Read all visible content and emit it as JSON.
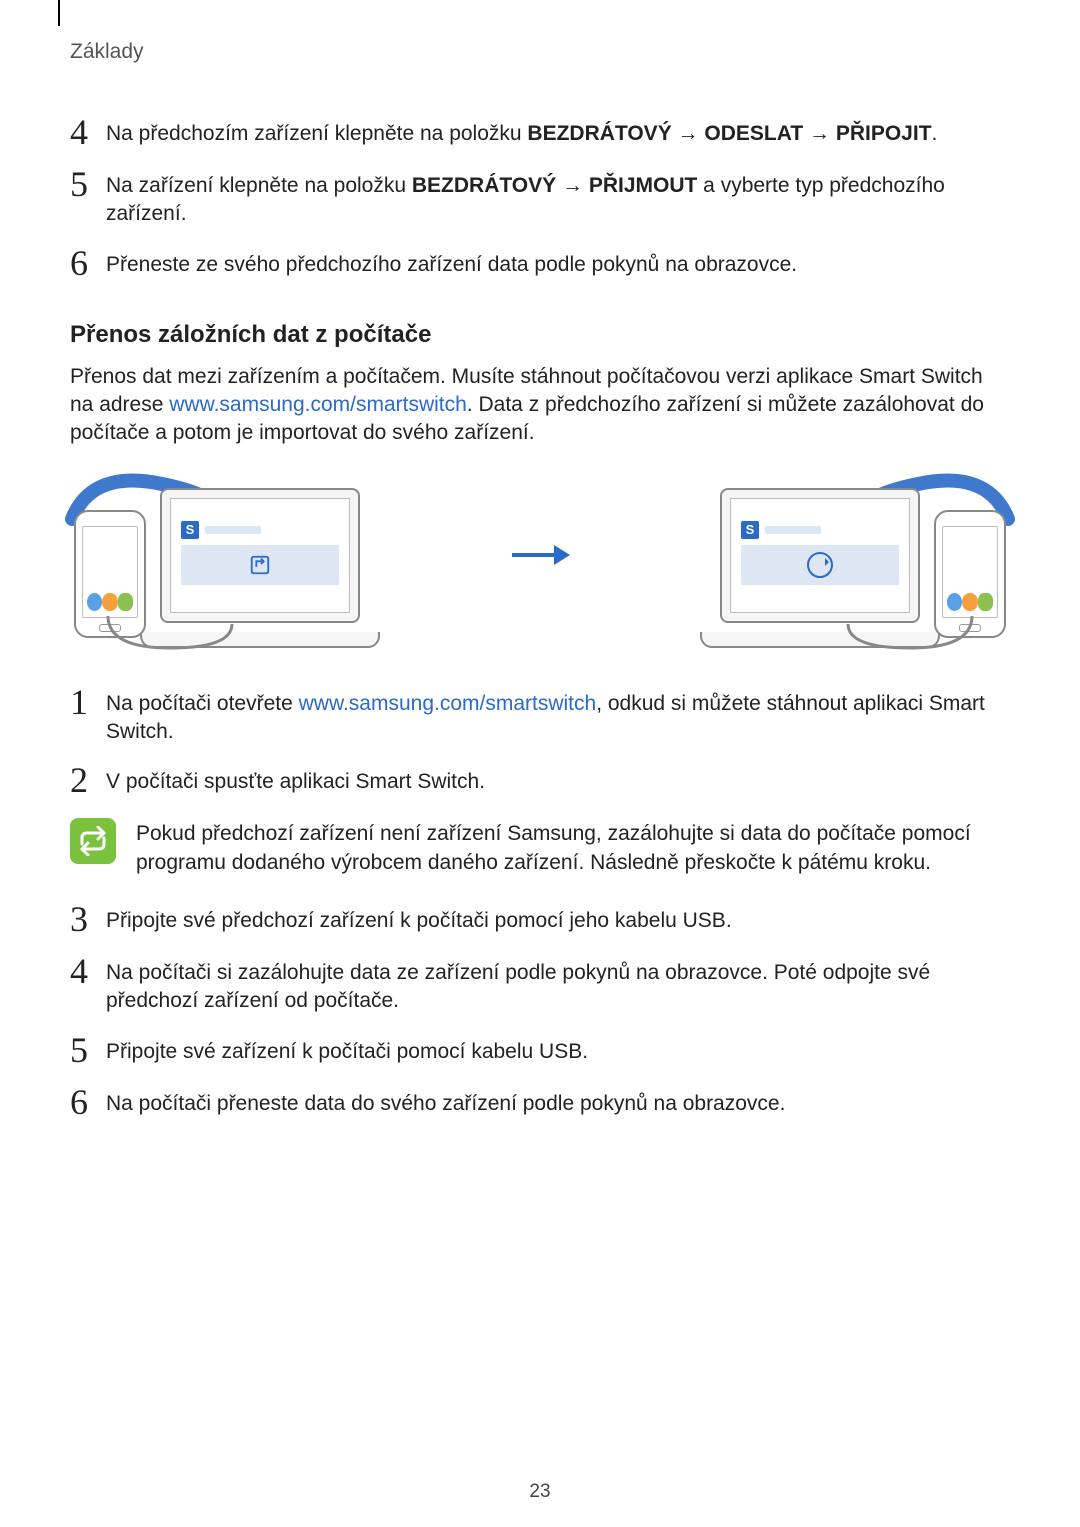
{
  "header": "Základy",
  "topSteps": [
    {
      "num": "4",
      "segments": [
        {
          "t": "Na předchozím zařízení klepněte na položku "
        },
        {
          "t": "BEZDRÁTOVÝ",
          "bold": true
        },
        {
          "t": " → "
        },
        {
          "t": "ODESLAT",
          "bold": true
        },
        {
          "t": " → "
        },
        {
          "t": "PŘIPOJIT",
          "bold": true
        },
        {
          "t": "."
        }
      ]
    },
    {
      "num": "5",
      "segments": [
        {
          "t": "Na zařízení klepněte na položku "
        },
        {
          "t": "BEZDRÁTOVÝ",
          "bold": true
        },
        {
          "t": " → "
        },
        {
          "t": "PŘIJMOUT",
          "bold": true
        },
        {
          "t": " a vyberte typ předchozího zařízení."
        }
      ]
    },
    {
      "num": "6",
      "segments": [
        {
          "t": "Přeneste ze svého předchozího zařízení data podle pokynů na obrazovce."
        }
      ]
    }
  ],
  "h2": "Přenos záložních dat z počítače",
  "intro": {
    "segments": [
      {
        "t": "Přenos dat mezi zařízením a počítačem. Musíte stáhnout počítačovou verzi aplikace Smart Switch na adrese "
      },
      {
        "t": "www.samsung.com/smartswitch",
        "link": true
      },
      {
        "t": ". Data z předchozího zařízení si můžete zazálohovat do počítače a potom je importovat do svého zařízení."
      }
    ]
  },
  "appBadge": "S",
  "steps": [
    {
      "num": "1",
      "segments": [
        {
          "t": "Na počítači otevřete "
        },
        {
          "t": "www.samsung.com/smartswitch",
          "link": true
        },
        {
          "t": ", odkud si můžete stáhnout aplikaci Smart Switch."
        }
      ]
    },
    {
      "num": "2",
      "segments": [
        {
          "t": "V počítači spusťte aplikaci Smart Switch."
        }
      ]
    }
  ],
  "note": "Pokud předchozí zařízení není zařízení Samsung, zazálohujte si data do počítače pomocí programu dodaného výrobcem daného zařízení. Následně přeskočte k pátému kroku.",
  "steps2": [
    {
      "num": "3",
      "segments": [
        {
          "t": "Připojte své předchozí zařízení k počítači pomocí jeho kabelu USB."
        }
      ]
    },
    {
      "num": "4",
      "segments": [
        {
          "t": "Na počítači si zazálohujte data ze zařízení podle pokynů na obrazovce. Poté odpojte své předchozí zařízení od počítače."
        }
      ]
    },
    {
      "num": "5",
      "segments": [
        {
          "t": "Připojte své zařízení k počítači pomocí kabelu USB."
        }
      ]
    },
    {
      "num": "6",
      "segments": [
        {
          "t": "Na počítači přeneste data do svého zařízení podle pokynů na obrazovce."
        }
      ]
    }
  ],
  "pageNumber": "23"
}
